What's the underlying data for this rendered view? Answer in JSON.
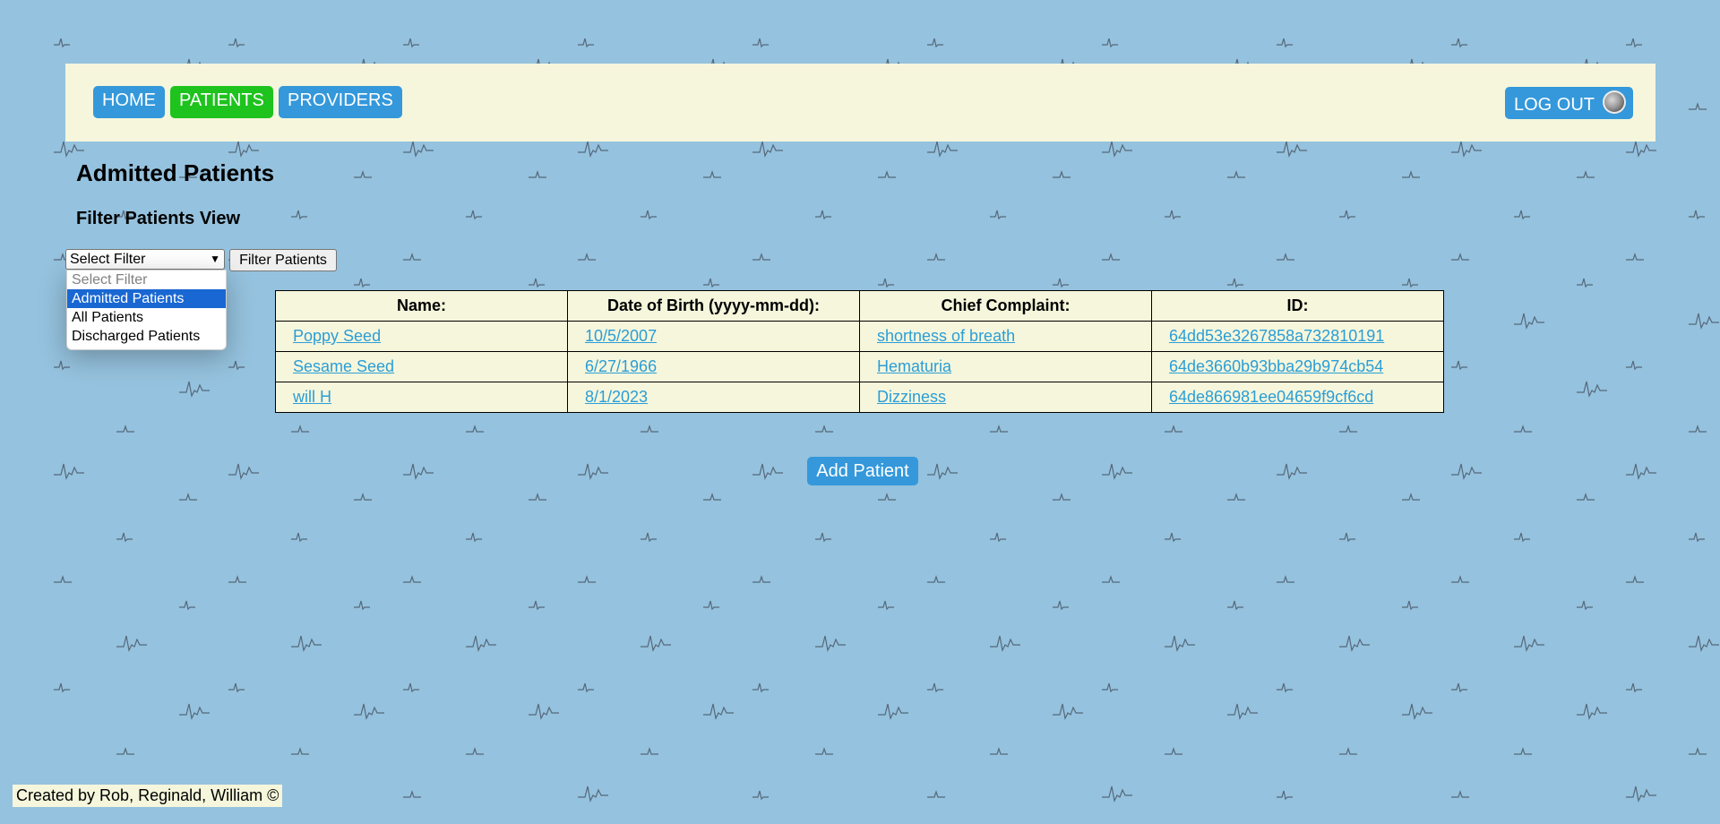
{
  "colors": {
    "background": "#95c2de",
    "panel": "#f6f6dc",
    "nav_blue": "#3498db",
    "nav_active_green": "#1ec31e",
    "link": "#2b9ed6",
    "dropdown_highlight": "#1967d2"
  },
  "nav": {
    "home": "HOME",
    "patients": "PATIENTS",
    "providers": "PROVIDERS",
    "logout": "LOG OUT",
    "active": "PATIENTS"
  },
  "page": {
    "title": "Admitted Patients",
    "filter_title": "Filter Patients View"
  },
  "filter": {
    "selected": "Select Filter",
    "button": "Filter Patients",
    "options": [
      {
        "label": "Select Filter",
        "state": "disabled"
      },
      {
        "label": "Admitted Patients",
        "state": "highlighted"
      },
      {
        "label": "All Patients",
        "state": "normal"
      },
      {
        "label": "Discharged Patients",
        "state": "normal"
      }
    ]
  },
  "table": {
    "headers": [
      "Name:",
      "Date of Birth (yyyy-mm-dd):",
      "Chief Complaint:",
      "ID:"
    ],
    "rows": [
      [
        "Poppy Seed",
        "10/5/2007",
        "shortness of breath",
        "64dd53e3267858a732810191"
      ],
      [
        "Sesame Seed",
        "6/27/1966",
        "Hematuria",
        "64de3660b93bba29b974cb54"
      ],
      [
        "will H",
        "8/1/2023",
        "Dizziness",
        "64de866981ee04659f9cf6cd"
      ]
    ]
  },
  "add_button": "Add Patient",
  "footer": "Created by Rob, Reginald, William ©",
  "icons": {
    "avatar": "user-avatar-icon",
    "select_arrow": "chevron-down-icon",
    "background": "ekg-heartbeat-pattern"
  }
}
